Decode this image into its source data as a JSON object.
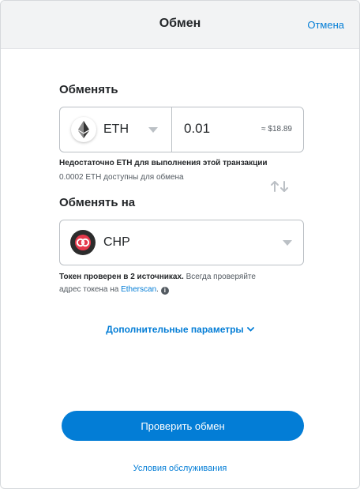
{
  "header": {
    "title": "Обмен",
    "cancel_label": "Отмена"
  },
  "swap_from": {
    "label": "Обменять",
    "token_symbol": "ETH",
    "token_icon": "ethereum-icon",
    "amount": "0.01",
    "fiat_value": "≈ $18.89",
    "warning": "Недостаточно ETH для выполнения этой транзакции",
    "available": "0.0002 ETH доступны для обмена"
  },
  "swap_to": {
    "label": "Обменять на",
    "token_symbol": "CHP",
    "token_icon": "chp-token-icon",
    "verified_bold": "Токен проверен в 2 источниках.",
    "verified_rest": " Всегда проверяйте",
    "verify_prefix": "адрес токена на ",
    "etherscan_link": "Etherscan",
    "verify_suffix": "."
  },
  "advanced_label": "Дополнительные параметры",
  "review_button": "Проверить обмен",
  "terms_link": "Условия обслуживания",
  "colors": {
    "accent": "#037dd6",
    "border": "#bbc0c5",
    "header_bg": "#f2f3f4",
    "text": "#24272a",
    "muted": "#535a61"
  }
}
